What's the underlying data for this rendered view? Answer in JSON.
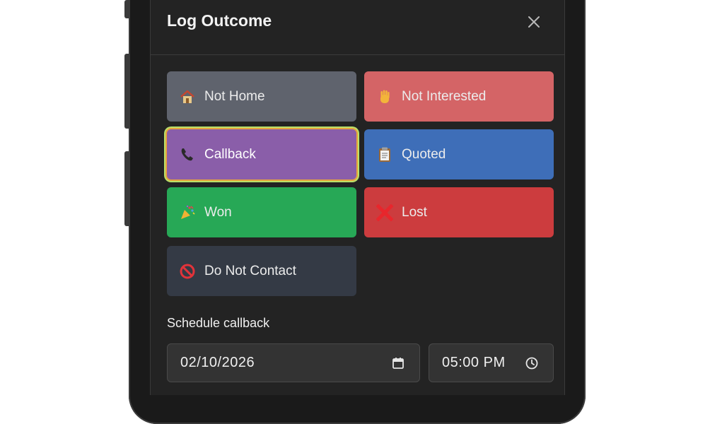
{
  "dialog": {
    "title": "Log Outcome",
    "close_icon": "close-icon"
  },
  "outcomes": [
    {
      "label": "Not Home",
      "icon": "house-icon",
      "color": "#5f636d",
      "selected": false
    },
    {
      "label": "Not Interested",
      "icon": "raised-hand-icon",
      "color": "#d46466",
      "selected": false
    },
    {
      "label": "Callback",
      "icon": "telephone-icon",
      "color": "#8a5ea9",
      "selected": true
    },
    {
      "label": "Quoted",
      "icon": "clipboard-icon",
      "color": "#3e6eb8",
      "selected": false
    },
    {
      "label": "Won",
      "icon": "party-popper-icon",
      "color": "#27a856",
      "selected": false
    },
    {
      "label": "Lost",
      "icon": "cross-mark-icon",
      "color": "#cc3c3e",
      "selected": false
    },
    {
      "label": "Do Not Contact",
      "icon": "no-entry-icon",
      "color": "#343a45",
      "selected": false
    }
  ],
  "schedule": {
    "label": "Schedule callback",
    "date_value": "02/10/2026",
    "date_icon": "calendar-icon",
    "time_value": "05:00 PM",
    "time_icon": "clock-icon"
  },
  "colors": {
    "selected_ring_inner": "#e8a43c",
    "selected_ring_outer": "#b9e06a",
    "modal_bg": "#232323"
  }
}
